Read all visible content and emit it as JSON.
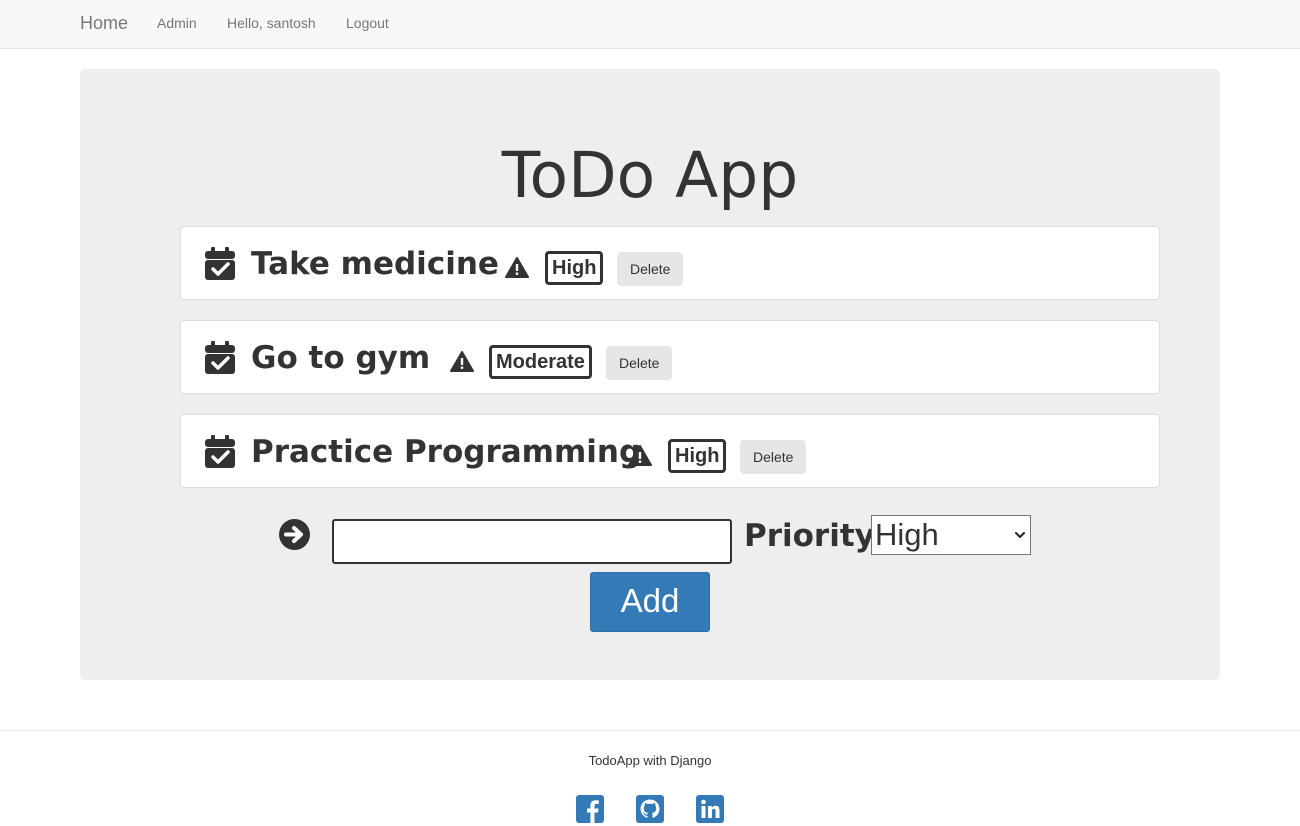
{
  "navbar": {
    "brand": "Home",
    "links": [
      "Admin",
      "Hello, santosh",
      "Logout"
    ]
  },
  "main": {
    "title": "ToDo App",
    "tasks": [
      {
        "text": "Take medicine",
        "priority": "High",
        "delete_label": "Delete"
      },
      {
        "text": "Go to gym",
        "priority": "Moderate",
        "delete_label": "Delete"
      },
      {
        "text": "Practice Programming",
        "priority": "High",
        "delete_label": "Delete"
      }
    ],
    "form": {
      "input_value": "",
      "priority_label": "Priority:",
      "priority_selected": "High",
      "add_label": "Add"
    }
  },
  "footer": {
    "text": "TodoApp with Django",
    "social_icons": [
      "facebook-icon",
      "github-icon",
      "linkedin-icon"
    ]
  },
  "colors": {
    "navbar_bg": "#f8f8f8",
    "jumbotron_bg": "#eeeeee",
    "primary": "#337ab7",
    "text": "#333333",
    "muted": "#777777"
  }
}
